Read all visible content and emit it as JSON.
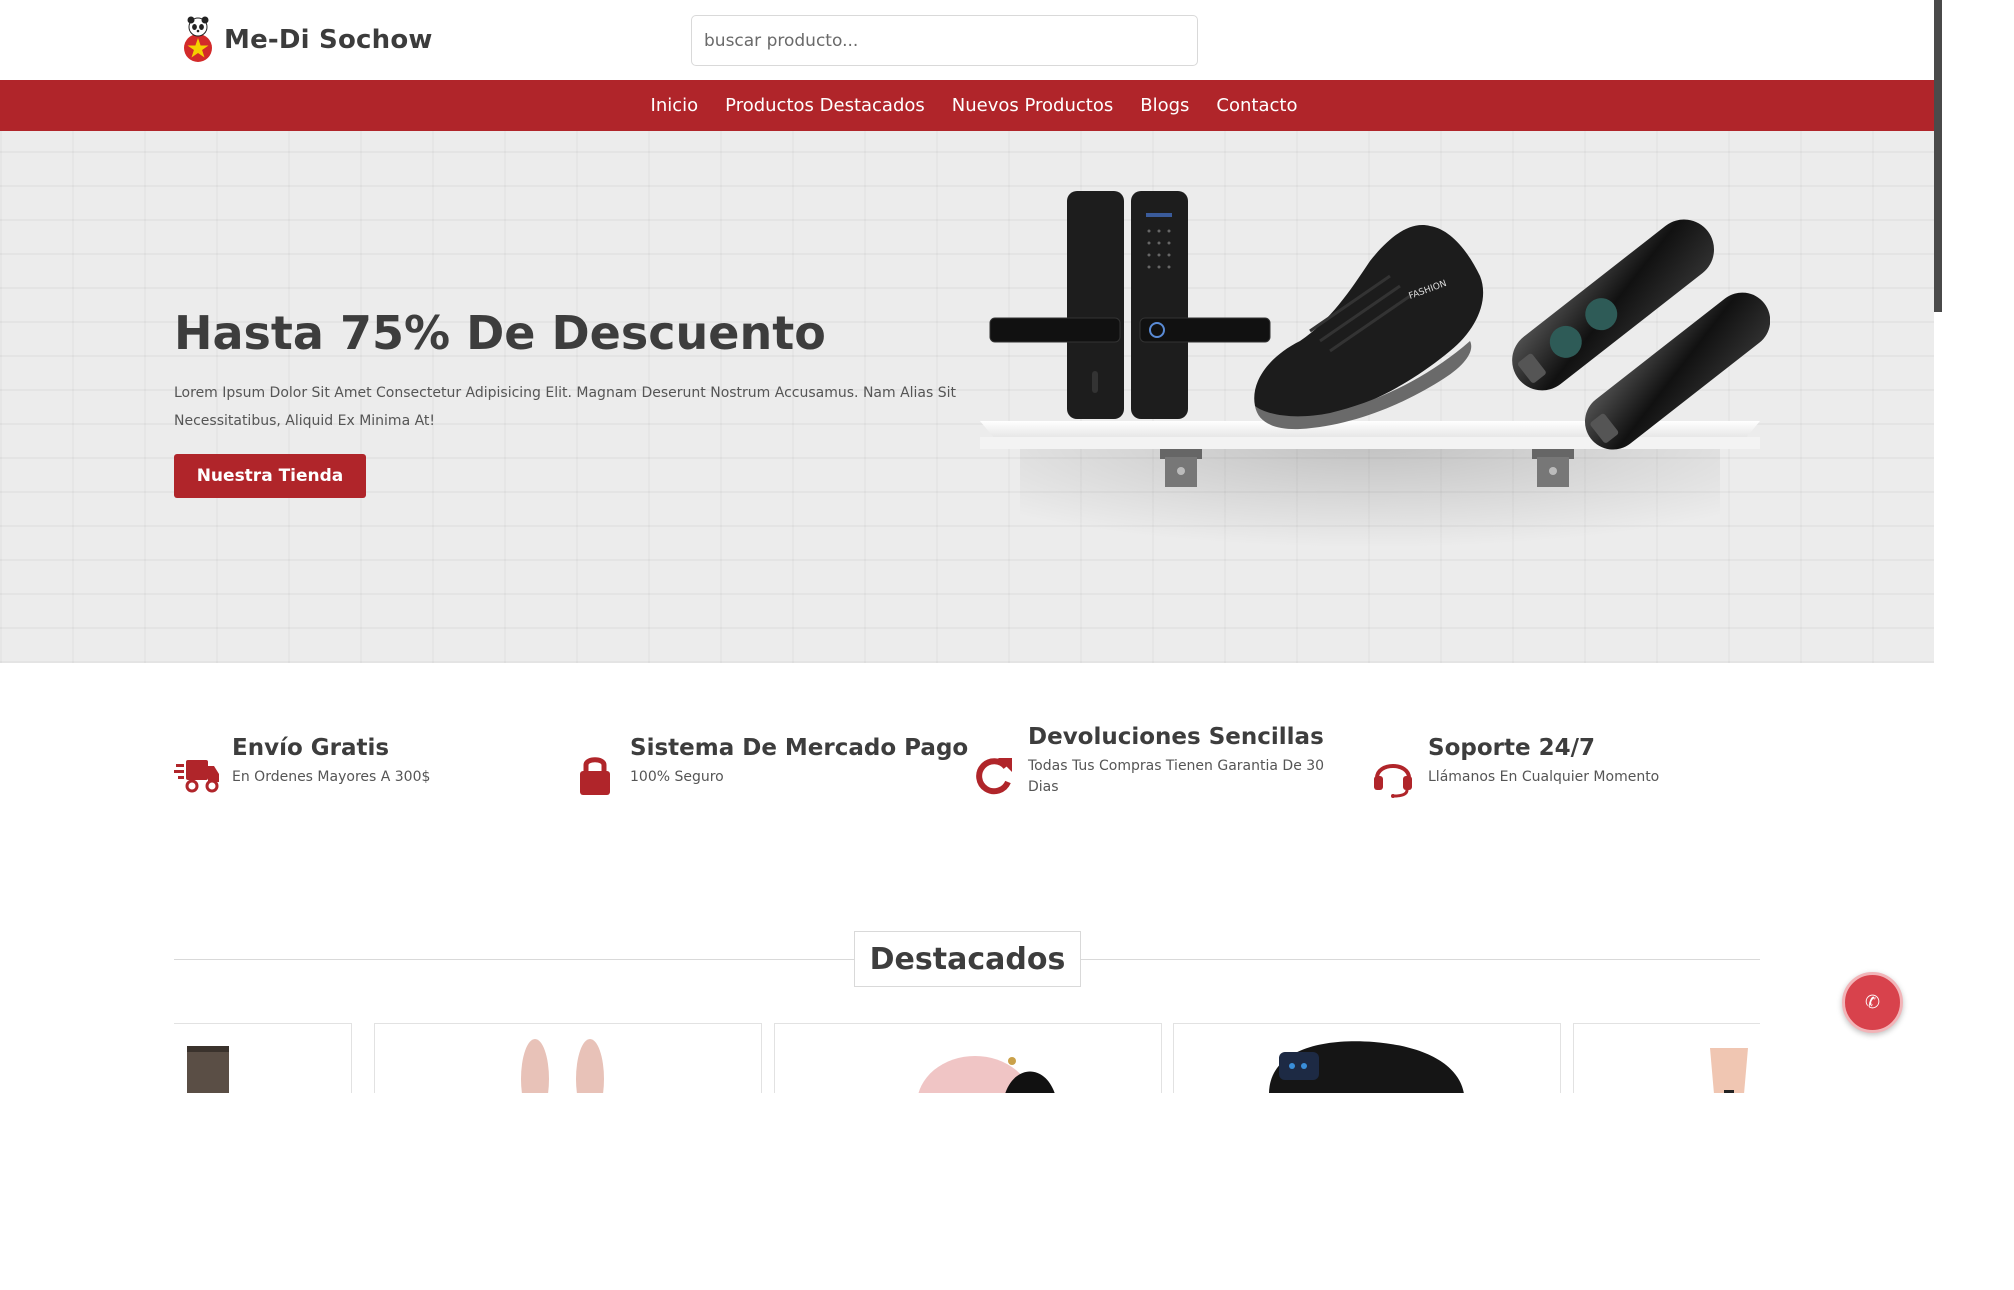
{
  "brand": {
    "name": "Me-Di Sochow",
    "accent": "#b0252a"
  },
  "search": {
    "placeholder": "buscar producto..."
  },
  "nav": {
    "items": [
      {
        "label": "Inicio"
      },
      {
        "label": "Productos Destacados"
      },
      {
        "label": "Nuevos Productos"
      },
      {
        "label": "Blogs"
      },
      {
        "label": "Contacto"
      }
    ]
  },
  "hero": {
    "title": "Hasta 75% De Descuento",
    "text": "Lorem Ipsum Dolor Sit Amet Consectetur Adipisicing Elit. Magnam Deserunt Nostrum Accusamus. Nam Alias Sit Necessitatibus, Aliquid Ex Minima At!",
    "button": "Nuestra Tienda",
    "shoe_brand": "FASHION",
    "products_shown": [
      "smart-door-lock",
      "sneaker",
      "wireless-earbuds"
    ]
  },
  "features": [
    {
      "icon": "truck-icon",
      "title": "Envío Gratis",
      "subtitle": "En Ordenes Mayores A 300$"
    },
    {
      "icon": "lock-icon",
      "title": "Sistema De Mercado Pago",
      "subtitle": "100% Seguro"
    },
    {
      "icon": "redo-icon",
      "title": "Devoluciones Sencillas",
      "subtitle": "Todas Tus Compras Tienen Garantia De 30 Dias"
    },
    {
      "icon": "headset-icon",
      "title": "Soporte 24/7",
      "subtitle": "Llámanos En Cualquier Momento"
    }
  ],
  "section": {
    "title": "Destacados"
  },
  "products": [
    {
      "name": "product-card-1"
    },
    {
      "name": "product-card-2"
    },
    {
      "name": "product-card-3"
    },
    {
      "name": "product-card-4"
    },
    {
      "name": "product-card-5"
    }
  ],
  "floating": {
    "icon": "phone-icon",
    "glyph": "✆"
  }
}
